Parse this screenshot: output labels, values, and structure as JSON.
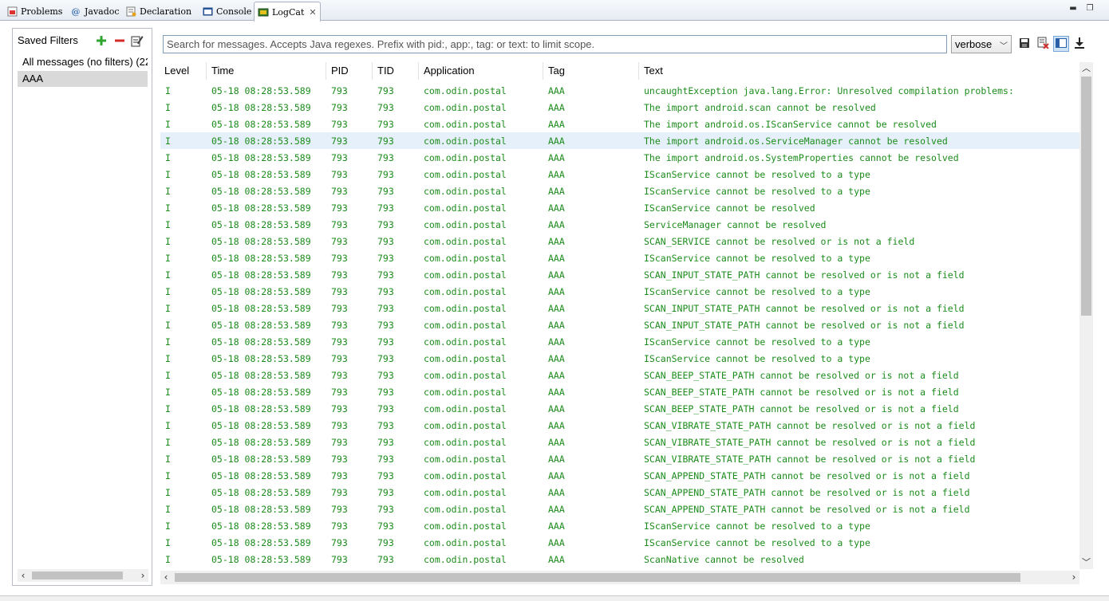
{
  "tabs": [
    {
      "label": "Problems",
      "icon": "problems-icon"
    },
    {
      "label": "Javadoc",
      "icon": "javadoc-icon"
    },
    {
      "label": "Declaration",
      "icon": "declaration-icon"
    },
    {
      "label": "Console",
      "icon": "console-icon"
    },
    {
      "label": "LogCat",
      "icon": "logcat-icon",
      "active": true
    }
  ],
  "filters": {
    "title": "Saved Filters",
    "items": [
      {
        "label": "All messages (no filters) (22"
      },
      {
        "label": "AAA",
        "selected": true
      }
    ]
  },
  "search": {
    "placeholder": "Search for messages. Accepts Java regexes. Prefix with pid:, app:, tag: or text: to limit scope."
  },
  "level_select": {
    "value": "verbose"
  },
  "table": {
    "columns": [
      "Level",
      "Time",
      "PID",
      "TID",
      "Application",
      "Tag",
      "Text"
    ],
    "rows": [
      [
        "I",
        "05-18 08:28:53.589",
        "793",
        "793",
        "com.odin.postal",
        "AAA",
        "uncaughtException   java.lang.Error: Unresolved compilation problems:"
      ],
      [
        "I",
        "05-18 08:28:53.589",
        "793",
        "793",
        "com.odin.postal",
        "AAA",
        "The import android.scan cannot be resolved"
      ],
      [
        "I",
        "05-18 08:28:53.589",
        "793",
        "793",
        "com.odin.postal",
        "AAA",
        "The import android.os.IScanService cannot be resolved"
      ],
      [
        "I",
        "05-18 08:28:53.589",
        "793",
        "793",
        "com.odin.postal",
        "AAA",
        "The import android.os.ServiceManager cannot be resolved"
      ],
      [
        "I",
        "05-18 08:28:53.589",
        "793",
        "793",
        "com.odin.postal",
        "AAA",
        "The import android.os.SystemProperties cannot be resolved"
      ],
      [
        "I",
        "05-18 08:28:53.589",
        "793",
        "793",
        "com.odin.postal",
        "AAA",
        "IScanService cannot be resolved to a type"
      ],
      [
        "I",
        "05-18 08:28:53.589",
        "793",
        "793",
        "com.odin.postal",
        "AAA",
        "IScanService cannot be resolved to a type"
      ],
      [
        "I",
        "05-18 08:28:53.589",
        "793",
        "793",
        "com.odin.postal",
        "AAA",
        "IScanService cannot be resolved"
      ],
      [
        "I",
        "05-18 08:28:53.589",
        "793",
        "793",
        "com.odin.postal",
        "AAA",
        "ServiceManager cannot be resolved"
      ],
      [
        "I",
        "05-18 08:28:53.589",
        "793",
        "793",
        "com.odin.postal",
        "AAA",
        "SCAN_SERVICE cannot be resolved or is not a field"
      ],
      [
        "I",
        "05-18 08:28:53.589",
        "793",
        "793",
        "com.odin.postal",
        "AAA",
        "IScanService cannot be resolved to a type"
      ],
      [
        "I",
        "05-18 08:28:53.589",
        "793",
        "793",
        "com.odin.postal",
        "AAA",
        "SCAN_INPUT_STATE_PATH cannot be resolved or is not a field"
      ],
      [
        "I",
        "05-18 08:28:53.589",
        "793",
        "793",
        "com.odin.postal",
        "AAA",
        "IScanService cannot be resolved to a type"
      ],
      [
        "I",
        "05-18 08:28:53.589",
        "793",
        "793",
        "com.odin.postal",
        "AAA",
        "SCAN_INPUT_STATE_PATH cannot be resolved or is not a field"
      ],
      [
        "I",
        "05-18 08:28:53.589",
        "793",
        "793",
        "com.odin.postal",
        "AAA",
        "SCAN_INPUT_STATE_PATH cannot be resolved or is not a field"
      ],
      [
        "I",
        "05-18 08:28:53.589",
        "793",
        "793",
        "com.odin.postal",
        "AAA",
        "IScanService cannot be resolved to a type"
      ],
      [
        "I",
        "05-18 08:28:53.589",
        "793",
        "793",
        "com.odin.postal",
        "AAA",
        "IScanService cannot be resolved to a type"
      ],
      [
        "I",
        "05-18 08:28:53.589",
        "793",
        "793",
        "com.odin.postal",
        "AAA",
        "SCAN_BEEP_STATE_PATH cannot be resolved or is not a field"
      ],
      [
        "I",
        "05-18 08:28:53.589",
        "793",
        "793",
        "com.odin.postal",
        "AAA",
        "SCAN_BEEP_STATE_PATH cannot be resolved or is not a field"
      ],
      [
        "I",
        "05-18 08:28:53.589",
        "793",
        "793",
        "com.odin.postal",
        "AAA",
        "SCAN_BEEP_STATE_PATH cannot be resolved or is not a field"
      ],
      [
        "I",
        "05-18 08:28:53.589",
        "793",
        "793",
        "com.odin.postal",
        "AAA",
        "SCAN_VIBRATE_STATE_PATH cannot be resolved or is not a field"
      ],
      [
        "I",
        "05-18 08:28:53.589",
        "793",
        "793",
        "com.odin.postal",
        "AAA",
        "SCAN_VIBRATE_STATE_PATH cannot be resolved or is not a field"
      ],
      [
        "I",
        "05-18 08:28:53.589",
        "793",
        "793",
        "com.odin.postal",
        "AAA",
        "SCAN_VIBRATE_STATE_PATH cannot be resolved or is not a field"
      ],
      [
        "I",
        "05-18 08:28:53.589",
        "793",
        "793",
        "com.odin.postal",
        "AAA",
        "SCAN_APPEND_STATE_PATH cannot be resolved or is not a field"
      ],
      [
        "I",
        "05-18 08:28:53.589",
        "793",
        "793",
        "com.odin.postal",
        "AAA",
        "SCAN_APPEND_STATE_PATH cannot be resolved or is not a field"
      ],
      [
        "I",
        "05-18 08:28:53.589",
        "793",
        "793",
        "com.odin.postal",
        "AAA",
        "SCAN_APPEND_STATE_PATH cannot be resolved or is not a field"
      ],
      [
        "I",
        "05-18 08:28:53.589",
        "793",
        "793",
        "com.odin.postal",
        "AAA",
        "IScanService cannot be resolved to a type"
      ],
      [
        "I",
        "05-18 08:28:53.589",
        "793",
        "793",
        "com.odin.postal",
        "AAA",
        "IScanService cannot be resolved to a type"
      ],
      [
        "I",
        "05-18 08:28:53.589",
        "793",
        "793",
        "com.odin.postal",
        "AAA",
        "ScanNative cannot be resolved"
      ]
    ],
    "highlighted_row": 3
  },
  "colors": {
    "info_text": "#1c8c1c",
    "highlight_row": "#e6f0fa",
    "selected_filter": "#d9d9d9"
  }
}
